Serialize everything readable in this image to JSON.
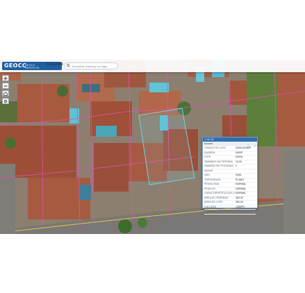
{
  "header": {
    "logo": "GEOCC",
    "subbrand": "GEOCC SERVICOS",
    "app_name": "Cidadão",
    "search_placeholder": "Encontrar endereço ou lugar"
  },
  "map_tools": [
    {
      "icon": "zoom-in-icon"
    },
    {
      "icon": "zoom-out-icon"
    },
    {
      "icon": "home-icon"
    },
    {
      "icon": "locate-icon"
    }
  ],
  "popup": {
    "title": "1 de 15",
    "subtitle": "Imóvel",
    "rows": [
      {
        "label": "CÓDIGO DO LOTE",
        "value": "0009120484P"
      },
      {
        "label": "QUADRA",
        "value": "0002P"
      },
      {
        "label": "LOTE",
        "value": "0002A"
      },
      {
        "label": "TAMANHO DA TESTADA",
        "value": "13.00"
      },
      {
        "label": "NÚMERO DE TESTADAS",
        "value": "1"
      },
      {
        "label": "VAGAS",
        "value": ""
      },
      {
        "label": "USO",
        "value": "VINA"
      },
      {
        "label": "TOPOGRAFIA",
        "value": "PLANO"
      },
      {
        "label": "PEDOLOGIA",
        "value": "NORMAL"
      },
      {
        "label": "PEDILHO",
        "value": "NORMAL"
      },
      {
        "label": "CARACTERÍSTICA DOS LIMITES",
        "value": "NORMAL"
      },
      {
        "label": "ÁREA DO TERRENO",
        "value": "360.00"
      },
      {
        "label": "ÁREA DO LOTE",
        "value": "360.00"
      },
      {
        "label": "CALÇADA",
        "value": "CAMPO"
      },
      {
        "label": "ESQUINA",
        "value": ""
      }
    ]
  }
}
